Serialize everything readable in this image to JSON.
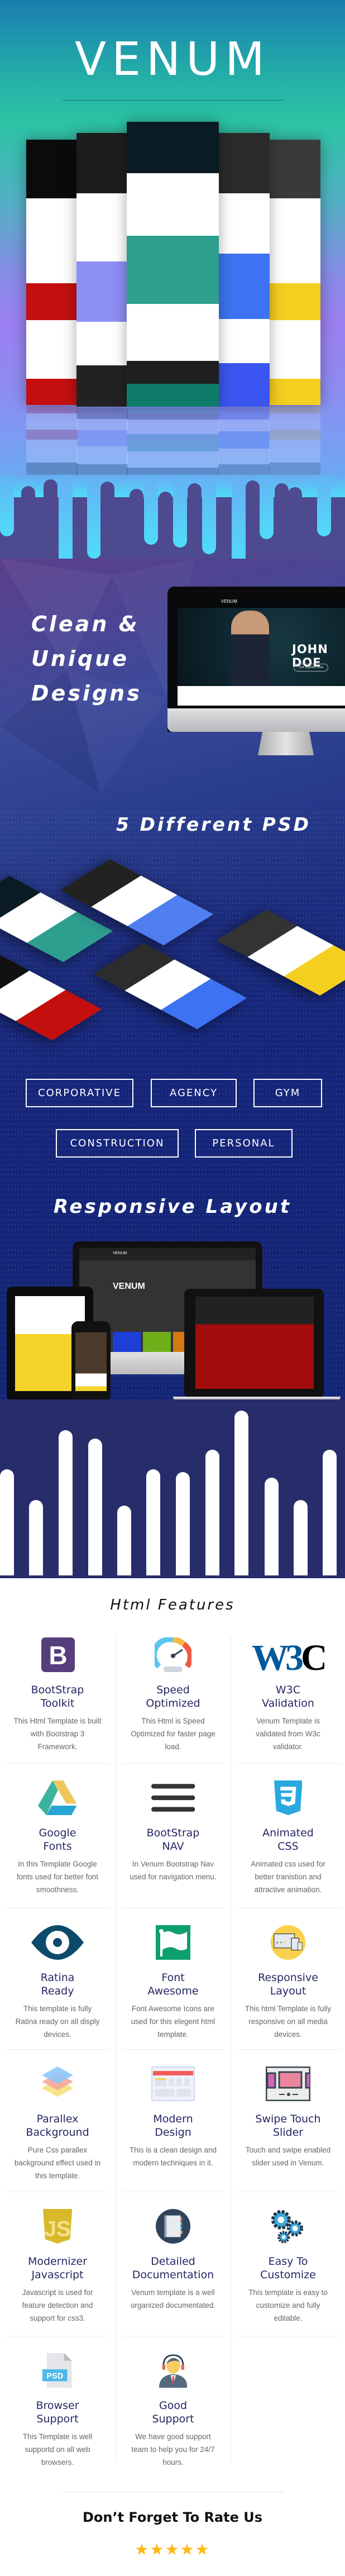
{
  "hero": {
    "title": "VENUM"
  },
  "mockup_text": {
    "name": "JOHN DOE",
    "brand": "VENUM",
    "cta": "Get Started Now"
  },
  "sections": {
    "clean_line1": "Clean &",
    "clean_line2": "Unique",
    "clean_line3": "Designs",
    "psd": "5 Different PSD",
    "responsive": "Responsive Layout"
  },
  "categories": [
    "CORPORATIVE",
    "AGENCY",
    "GYM",
    "CONSTRUCTION",
    "PERSONAL"
  ],
  "features_title": "Html Features",
  "features": [
    {
      "icon": "bootstrap-icon",
      "t1": "BootStrap",
      "t2": "Toolkit",
      "desc": "This Html Template is built with Bootstrap 3 Framework."
    },
    {
      "icon": "speedometer-icon",
      "t1": "Speed",
      "t2": "Optimized",
      "desc": "This Html is Speed Optimized for faster page load."
    },
    {
      "icon": "w3c-icon",
      "t1": "W3C",
      "t2": "Validation",
      "desc": "Venum Template is validated from W3c validator."
    },
    {
      "icon": "google-drive-icon",
      "t1": "Google",
      "t2": "Fonts",
      "desc": "In this Template Google fonts used for better font smoothness."
    },
    {
      "icon": "hamburger-menu-icon",
      "t1": "BootStrap",
      "t2": "NAV",
      "desc": "In Venum Bootstrap Nav used for navigation menu."
    },
    {
      "icon": "css3-icon",
      "t1": "Animated",
      "t2": "CSS",
      "desc": "Animated css used for better tranistion and attractive animation."
    },
    {
      "icon": "eye-icon",
      "t1": "Ratina",
      "t2": "Ready",
      "desc": "This template is fully Ratina ready on all disply devices."
    },
    {
      "icon": "flag-icon",
      "t1": "Font",
      "t2": "Awesome",
      "desc": "Font Awesome Icons are used for this elegent html template."
    },
    {
      "icon": "devices-icon",
      "t1": "Responsive",
      "t2": "Layout",
      "desc": "This html Template is fully responsive on all media devices."
    },
    {
      "icon": "layers-icon",
      "t1": "Parallex",
      "t2": "Background",
      "desc": "Pure Css parallex background effect used in this template."
    },
    {
      "icon": "browser-window-icon",
      "t1": "Modern",
      "t2": "Design",
      "desc": "This is a clean design and modern techniques in it."
    },
    {
      "icon": "slider-icon",
      "t1": "Swipe Touch",
      "t2": "Slider",
      "desc": "Touch and swipe enabled slider used in Venum."
    },
    {
      "icon": "javascript-icon",
      "t1": "Modernizer",
      "t2": "Javascript",
      "desc": "Javascript is used for feature detection and support for css3."
    },
    {
      "icon": "notebook-icon",
      "t1": "Detailed",
      "t2": "Documentation",
      "desc": "Venum template is a well organized documentated."
    },
    {
      "icon": "gears-icon",
      "t1": "Easy To",
      "t2": "Customize",
      "desc": "This template is easy to customize and fully editable."
    },
    {
      "icon": "psd-file-icon",
      "t1": "Browser",
      "t2": "Support",
      "desc": "This Template is well supportd on all web browsers."
    },
    {
      "icon": "support-agent-icon",
      "t1": "Good",
      "t2": "Support",
      "desc": "We have good support team to help you for 24/7 hours."
    }
  ],
  "rate": {
    "title": "Don’t Forget To Rate Us",
    "stars": 5,
    "star_color": "#fdb913"
  },
  "colors": {
    "feature_title": "#232862",
    "navy": "#272c6a",
    "teal": "#2cc4a4"
  }
}
